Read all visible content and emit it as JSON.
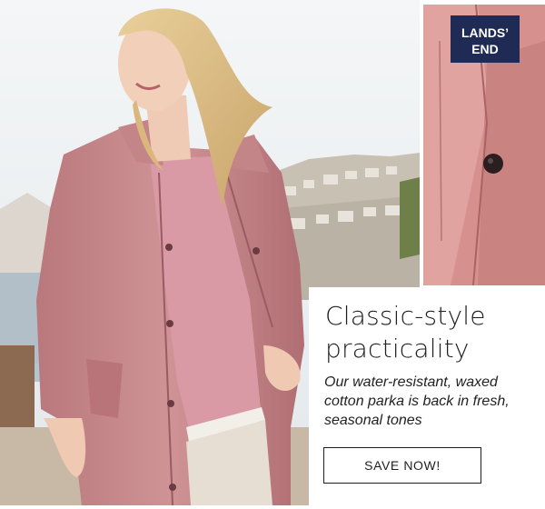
{
  "hero_image": {
    "subject": "woman-wearing-pink-parka"
  },
  "detail_image": {
    "logo_text": "LANDS' END"
  },
  "promo": {
    "headline": "Classic-style practicality",
    "body": "Our water-resistant, waxed cotton parka is back in fresh, seasonal tones",
    "cta_label": "SAVE NOW!"
  },
  "colors": {
    "parka_pink": "#c98a8a",
    "text": "#1f1f1f",
    "logo_navy": "#1f2a55"
  }
}
